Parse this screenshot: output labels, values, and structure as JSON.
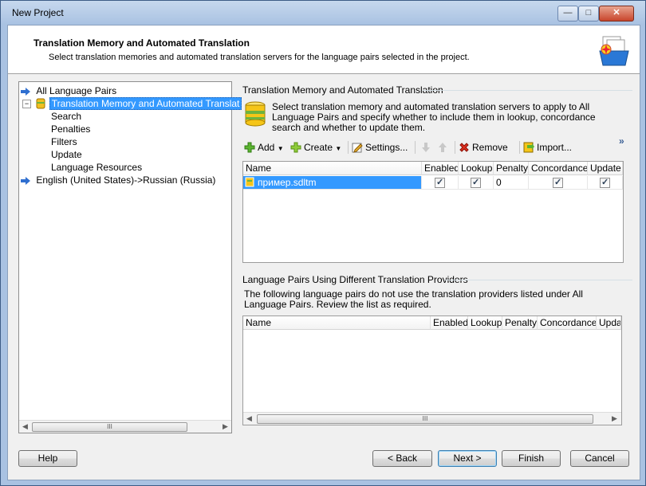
{
  "window": {
    "title": "New Project"
  },
  "header": {
    "title": "Translation Memory and Automated Translation",
    "subtitle": "Select translation memories and automated translation servers for the language pairs selected in the project."
  },
  "nav": {
    "items": [
      {
        "label": "All Language Pairs"
      },
      {
        "label": "Translation Memory and Automated Translat"
      },
      {
        "label": "Search"
      },
      {
        "label": "Penalties"
      },
      {
        "label": "Filters"
      },
      {
        "label": "Update"
      },
      {
        "label": "Language Resources"
      },
      {
        "label": "English (United States)->Russian (Russia)"
      }
    ]
  },
  "tm_panel": {
    "title": "Translation Memory and Automated Translation",
    "info": "Select translation memory and automated translation servers to apply to All Language Pairs and specify whether to include them in lookup, concordance search and whether to update them.",
    "toolbar": {
      "add": "Add",
      "create": "Create",
      "settings": "Settings...",
      "remove": "Remove",
      "import": "Import...",
      "more": "»"
    },
    "columns": [
      "Name",
      "Enabled",
      "Lookup",
      "Penalty",
      "Concordance",
      "Update"
    ],
    "rows": [
      {
        "name": "пример.sdltm",
        "penalty": "0"
      }
    ]
  },
  "pairs_panel": {
    "title": "Language Pairs Using Different Translation Providers",
    "info": "The following language pairs do not use the translation providers listed under All Language Pairs. Review the list as required.",
    "columns": [
      "Name",
      "Enabled",
      "Lookup",
      "Penalty",
      "Concordance",
      "Upda"
    ]
  },
  "buttons": {
    "help": "Help",
    "back": "< Back",
    "next": "Next >",
    "finish": "Finish",
    "cancel": "Cancel"
  },
  "scroll": {
    "thumb": "III"
  }
}
